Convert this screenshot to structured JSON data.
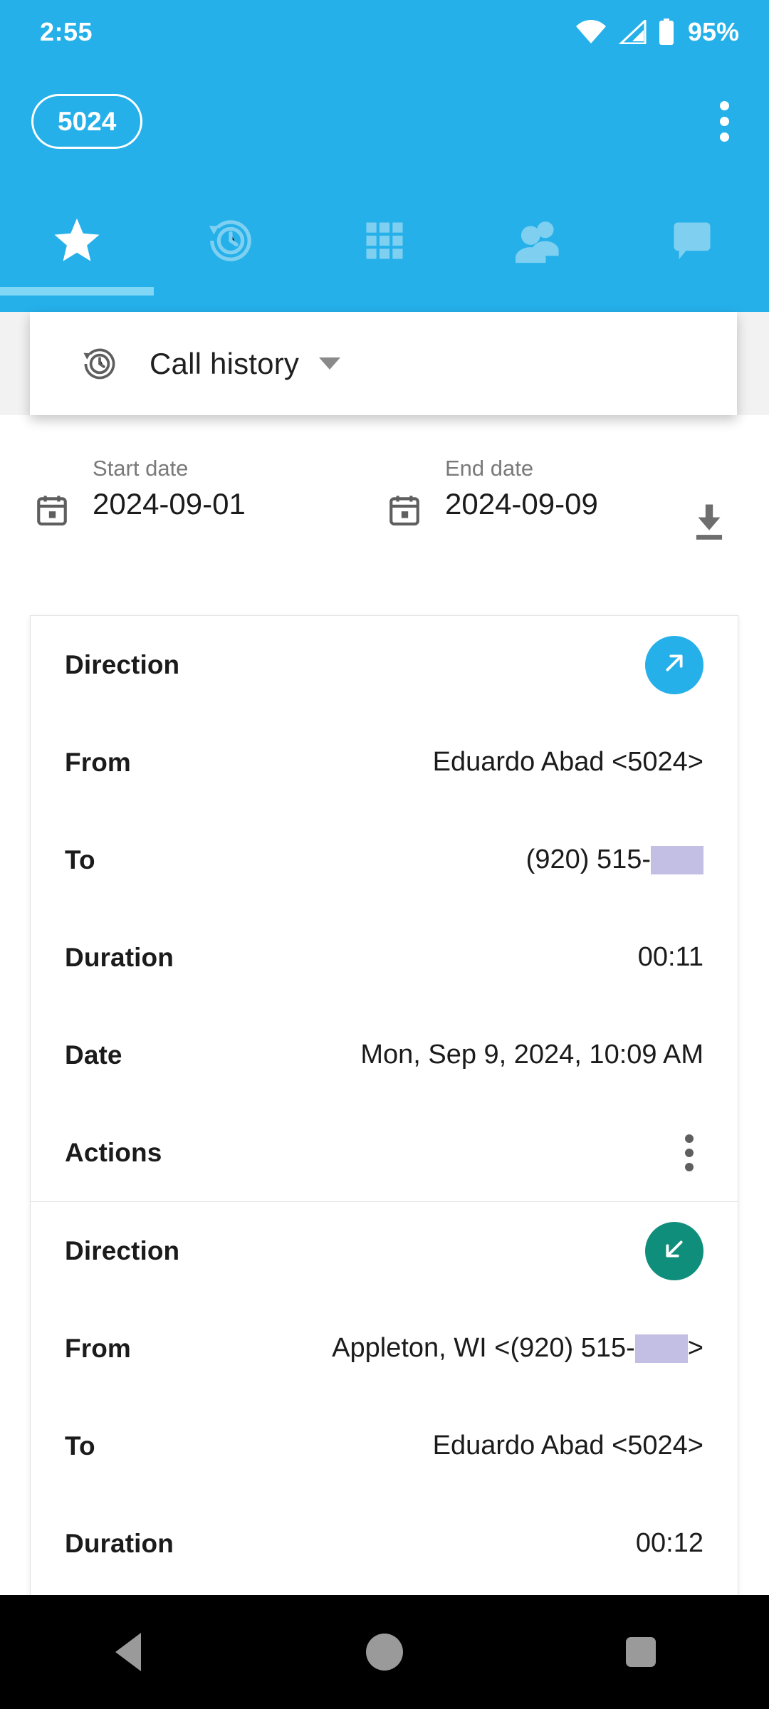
{
  "status_bar": {
    "time": "2:55",
    "battery_percent": "95%",
    "wifi_icon": "wifi-icon",
    "signal_icon": "cellular-signal-icon",
    "battery_icon": "battery-icon"
  },
  "app_bar": {
    "extension_chip": "5024",
    "overflow_icon": "overflow-menu-icon"
  },
  "tabs": [
    {
      "name": "favorites",
      "icon": "star-icon",
      "active": true
    },
    {
      "name": "history",
      "icon": "history-clock-icon",
      "active": false
    },
    {
      "name": "dialpad",
      "icon": "dialpad-grid-icon",
      "active": false
    },
    {
      "name": "contacts",
      "icon": "people-icon",
      "active": false
    },
    {
      "name": "messages",
      "icon": "chat-bubble-icon",
      "active": false
    }
  ],
  "selector": {
    "icon": "history-clock-icon",
    "label": "Call history",
    "caret_icon": "chevron-down-icon"
  },
  "date_filter": {
    "start_caption": "Start date",
    "start_value": "2024-09-01",
    "end_caption": "End date",
    "end_value": "2024-09-09",
    "calendar_icon": "calendar-icon",
    "download_icon": "download-icon"
  },
  "records": [
    {
      "direction_label": "Direction",
      "direction_type": "outgoing",
      "direction_icon": "arrow-up-right-icon",
      "from_label": "From",
      "from_value": "Eduardo Abad <5024>",
      "from_redacted": false,
      "to_label": "To",
      "to_value_prefix": "(920) 515-",
      "to_value_suffix": "",
      "to_redacted": true,
      "duration_label": "Duration",
      "duration_value": "00:11",
      "date_label": "Date",
      "date_value": "Mon, Sep 9, 2024, 10:09 AM",
      "actions_label": "Actions",
      "actions_icon": "overflow-menu-icon"
    },
    {
      "direction_label": "Direction",
      "direction_type": "incoming",
      "direction_icon": "arrow-down-left-icon",
      "from_label": "From",
      "from_value_prefix": "Appleton, WI <(920) 515-",
      "from_value_suffix": ">",
      "from_redacted": true,
      "to_label": "To",
      "to_value": "Eduardo Abad <5024>",
      "to_redacted": false,
      "duration_label": "Duration",
      "duration_value": "00:12"
    }
  ],
  "nav_bar": {
    "back_icon": "back-triangle-icon",
    "home_icon": "home-circle-icon",
    "recents_icon": "recents-square-icon"
  },
  "colors": {
    "brand_blue": "#25b0ea",
    "tab_indicator": "#7fd6f5",
    "outgoing_badge": "#25b0ea",
    "incoming_badge": "#0f8f7b",
    "redaction": "#c3bee4"
  }
}
